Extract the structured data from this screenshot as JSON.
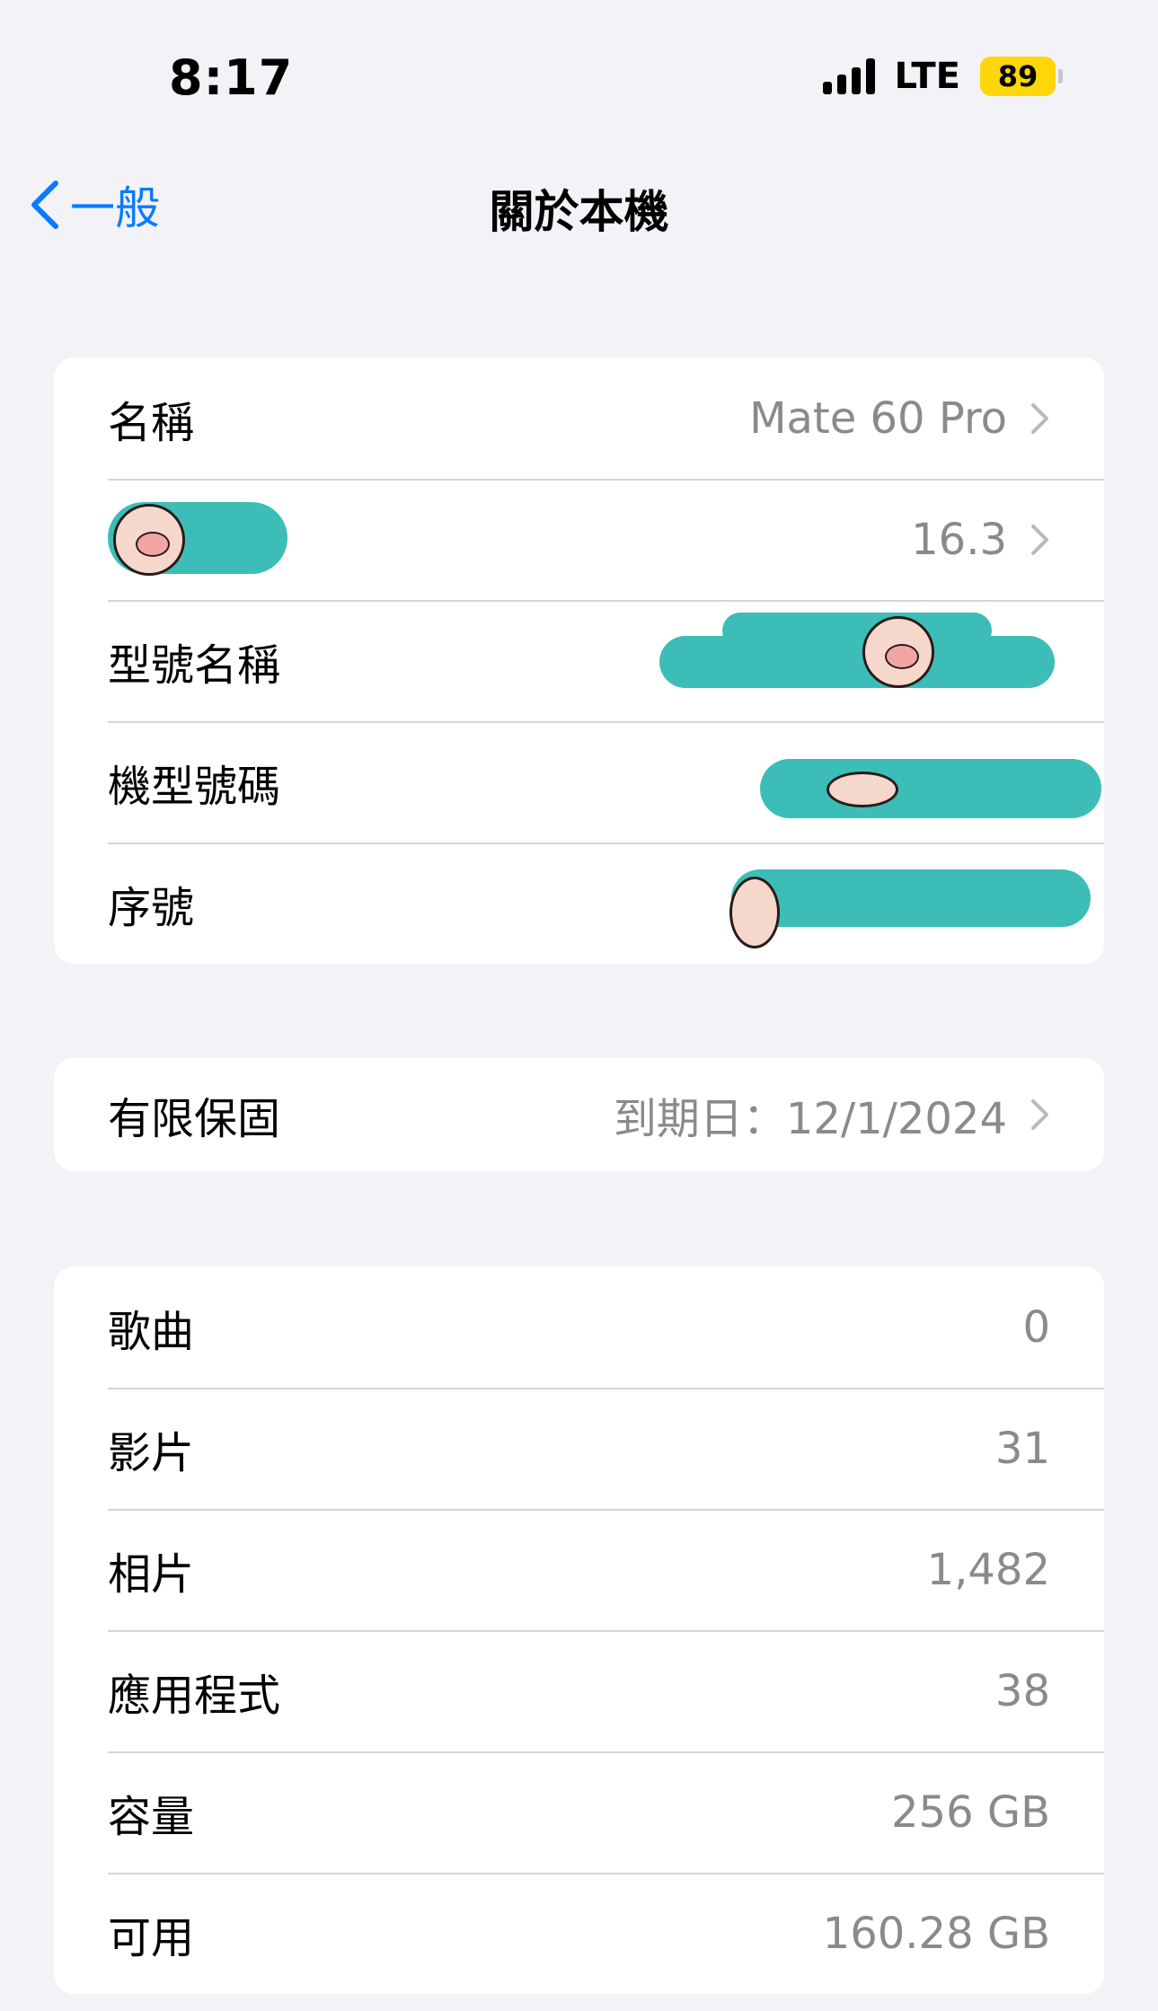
{
  "status_bar": {
    "time": "8:17",
    "carrier": "LTE",
    "battery": "89"
  },
  "nav": {
    "back_label": "一般",
    "title": "關於本機"
  },
  "info_group": [
    {
      "label": "名稱",
      "value": "Mate 60 Pro",
      "chevron": true
    },
    {
      "label": "",
      "value": "16.3",
      "chevron": true,
      "label_redacted": true
    },
    {
      "label": "型號名稱",
      "value": "",
      "chevron": false,
      "value_redacted": true
    },
    {
      "label": "機型號碼",
      "value": "",
      "chevron": false,
      "value_redacted": true
    },
    {
      "label": "序號",
      "value": "",
      "chevron": false,
      "value_redacted": true
    }
  ],
  "warranty": {
    "label": "有限保固",
    "value": "到期日：12/1/2024"
  },
  "stats_group": [
    {
      "label": "歌曲",
      "value": "0"
    },
    {
      "label": "影片",
      "value": "31"
    },
    {
      "label": "相片",
      "value": "1,482"
    },
    {
      "label": "應用程式",
      "value": "38"
    },
    {
      "label": "容量",
      "value": "256 GB"
    },
    {
      "label": "可用",
      "value": "160.28 GB"
    }
  ],
  "colors": {
    "accent": "#0a7aff",
    "background": "#f2f2f7",
    "secondary_text": "#8a8a8e",
    "battery": "#ffd60a",
    "redaction": "#3dbdb7"
  },
  "icons": {
    "back": "chevron-left-icon",
    "row_disclosure": "chevron-right-icon"
  }
}
